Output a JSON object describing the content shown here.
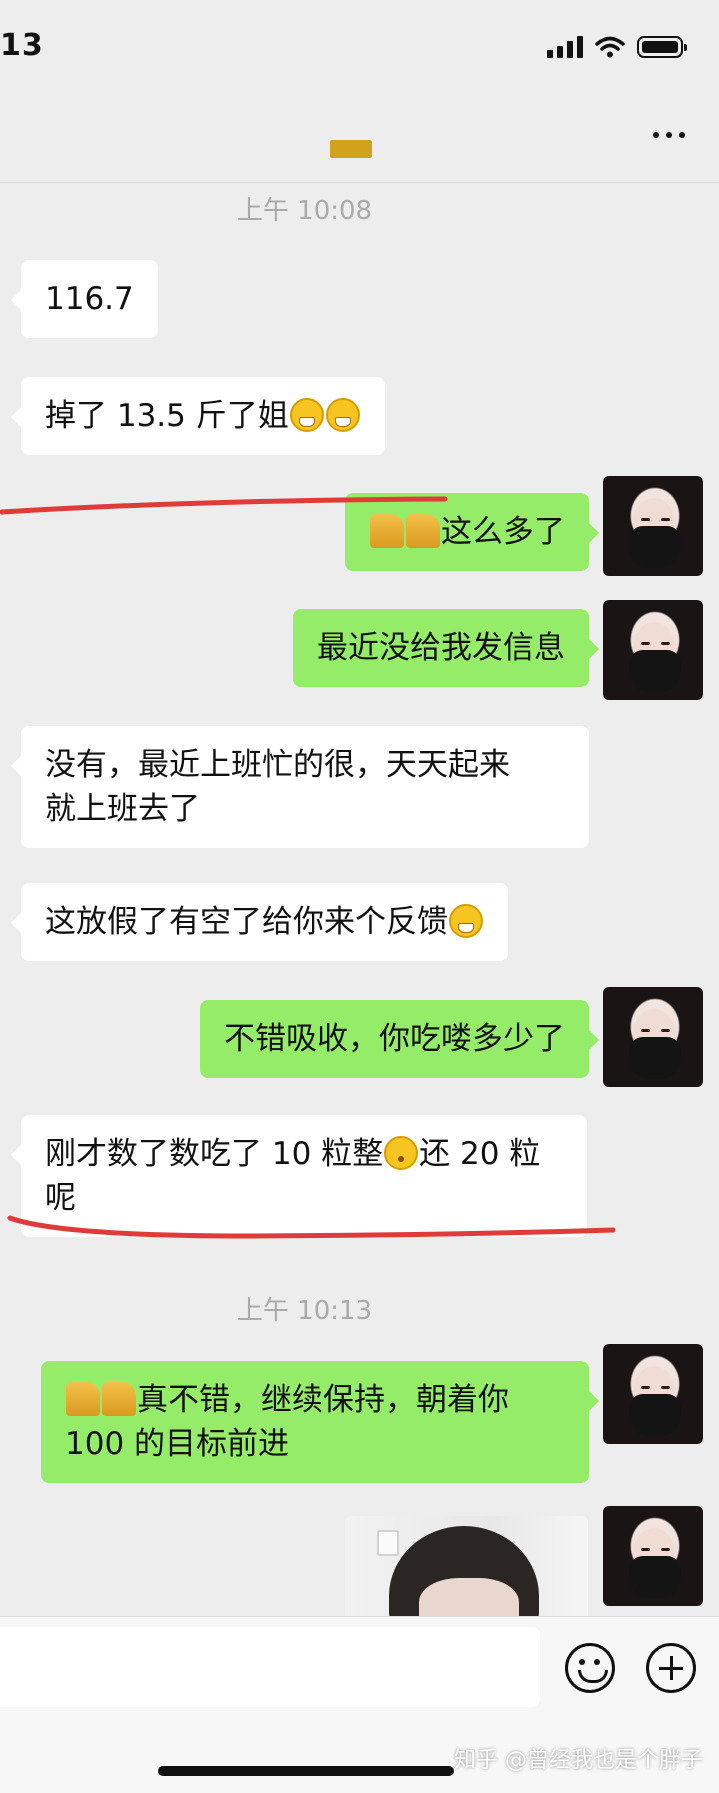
{
  "status_bar": {
    "time": "13"
  },
  "chat": {
    "timestamps": [
      "上午 10:08",
      "上午 10:13"
    ],
    "messages": {
      "m1": "116.7",
      "m2": "掉了 13.5 斤了姐",
      "m3": "这么多了",
      "m4": "最近没给我发信息",
      "m5_line1": "没有，最近上班忙的很，天天起来",
      "m5_line2": "就上班去了",
      "m6": "这放假了有空了给你来个反馈",
      "m7": "不错吸收，你吃喽多少了",
      "m8_part1": "刚才数了数吃了 10 粒整",
      "m8_part2": "还 20 粒",
      "m8_line2": "呢",
      "m9_line1": "真不错，继续保持，朝着你",
      "m9_line2": "100 的目标前进"
    }
  },
  "watermark": "知乎 @曾经我也是个胖子",
  "colors": {
    "sent_bubble": "#95ec69",
    "received_bubble": "#ffffff",
    "background": "#ededed",
    "highlight_line": "#e03b3b"
  },
  "icons": [
    "signal-icon",
    "wifi-icon",
    "battery-icon",
    "more-icon",
    "emoji-icon",
    "plus-icon",
    "grin-emoji",
    "thinking-emoji",
    "thumbs-up-emoji"
  ]
}
